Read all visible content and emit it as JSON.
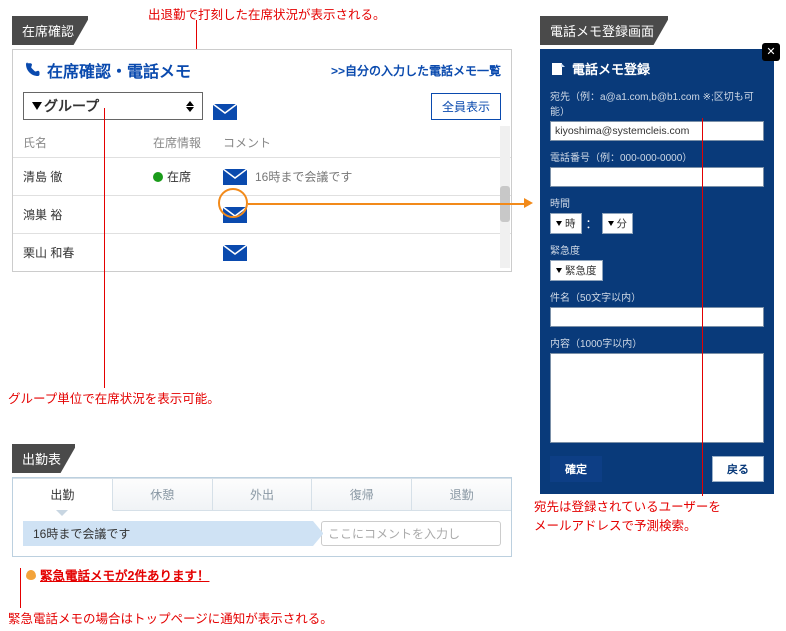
{
  "badges": {
    "presence": "在席確認",
    "memo": "電話メモ登録画面",
    "attend": "出勤表"
  },
  "callouts": {
    "status_shown": "出退勤で打刻した在席状況が表示される。",
    "group_filter": "グループ単位で在席状況を表示可能。",
    "recipient_search": "宛先は登録されているユーザーをメールアドレスで予測検索。",
    "alert_home": "緊急電話メモの場合はトップページに通知が表示される。"
  },
  "presence": {
    "title": "在席確認・電話メモ",
    "memo_list_link": ">>自分の入力した電話メモ一覧",
    "group_select": "グループ",
    "show_all": "全員表示",
    "columns": {
      "name": "氏名",
      "status": "在席情報",
      "comment": "コメント"
    },
    "rows": [
      {
        "name": "清島 徹",
        "status": "在席",
        "comment": "16時まで会議です"
      },
      {
        "name": "鴻巣 裕",
        "status": "",
        "comment": ""
      },
      {
        "name": "栗山 和春",
        "status": "",
        "comment": ""
      }
    ]
  },
  "attend": {
    "tabs": [
      "出勤",
      "休憩",
      "外出",
      "復帰",
      "退勤"
    ],
    "active_tab": 0,
    "comment_tag": "16時まで会議です",
    "comment_placeholder": "ここにコメントを入力し",
    "alert_text": "緊急電話メモが2件あります！"
  },
  "memo": {
    "title": "電話メモ登録",
    "to_label": "宛先（例：a@a1.com,b@b1.com ※;区切も可能）",
    "to_value": "kiyoshima@systemcleis.com",
    "phone_label": "電話番号（例：000-000-0000）",
    "time_label": "時間",
    "time_hour": "時",
    "time_min": "分",
    "urgency_label": "緊急度",
    "urgency_value": "緊急度",
    "subject_label": "件名（50文字以内）",
    "body_label": "内容（1000字以内）",
    "confirm": "確定",
    "back": "戻る"
  }
}
